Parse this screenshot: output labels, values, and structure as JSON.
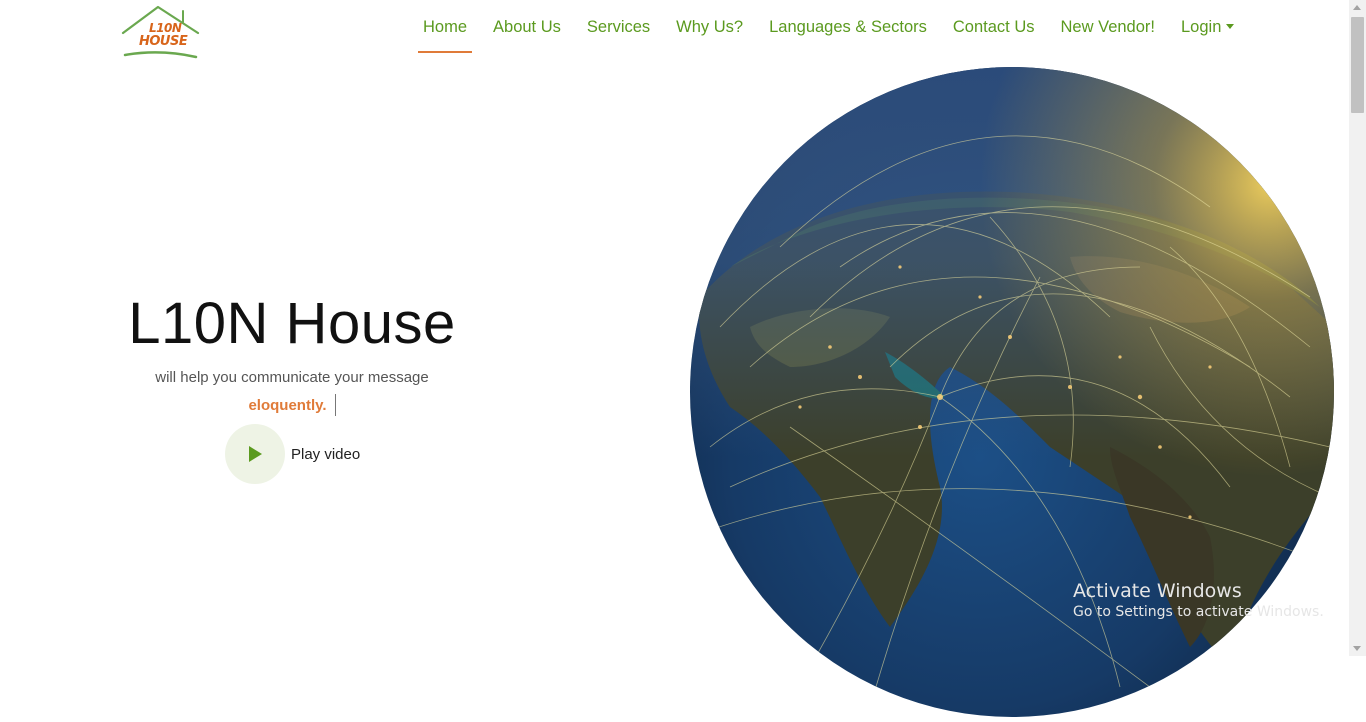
{
  "brand": {
    "logo_line1": "L10N",
    "logo_line2": "HOUSE"
  },
  "nav": {
    "items": [
      {
        "label": "Home",
        "active": true
      },
      {
        "label": "About Us"
      },
      {
        "label": "Services"
      },
      {
        "label": "Why Us?"
      },
      {
        "label": "Languages & Sectors"
      },
      {
        "label": "Contact Us"
      },
      {
        "label": "New Vendor!"
      },
      {
        "label": "Login",
        "dropdown": true
      }
    ]
  },
  "hero": {
    "title": "L10N House",
    "subtitle": "will help you communicate your message",
    "typed_word": "eloquently.",
    "play_label": "Play video"
  },
  "watermark": {
    "title": "Activate Windows",
    "subtitle": "Go to Settings to activate Windows."
  },
  "colors": {
    "nav_green": "#5b9a1f",
    "accent_orange": "#e07b39",
    "play_bg": "#eef3e5"
  },
  "icons": {
    "play": "play-icon",
    "globe": "globe-image"
  }
}
